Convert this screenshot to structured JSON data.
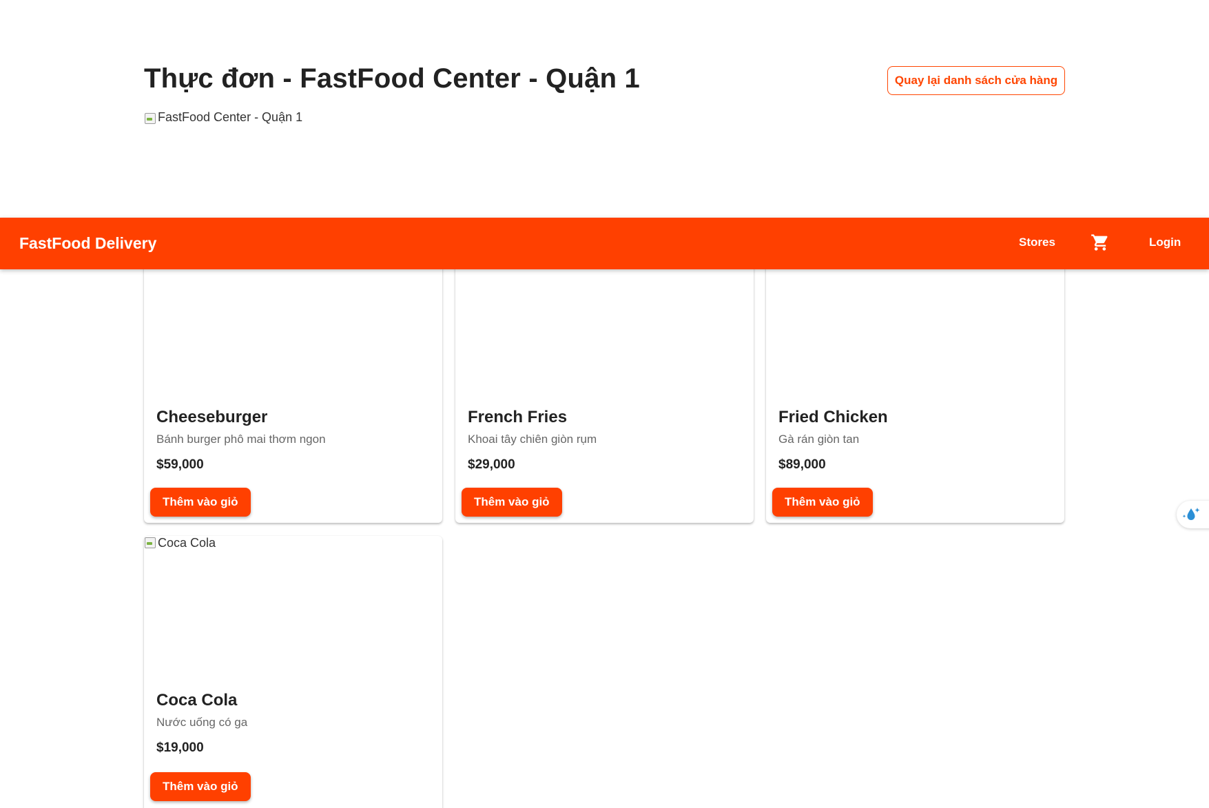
{
  "header": {
    "title": "Thực đơn - FastFood Center - Quận 1",
    "back_button": "Quay lại danh sách cửa hàng",
    "store_image_alt": "FastFood Center - Quận 1"
  },
  "navbar": {
    "brand": "FastFood Delivery",
    "stores": "Stores",
    "login": "Login",
    "cart_icon": "shopping-cart-icon"
  },
  "menu": {
    "items": [
      {
        "name": "Cheeseburger",
        "description": "Bánh burger phô mai thơm ngon",
        "price": "$59,000",
        "image_alt": "",
        "button": "Thêm vào giỏ"
      },
      {
        "name": "French Fries",
        "description": "Khoai tây chiên giòn rụm",
        "price": "$29,000",
        "image_alt": "",
        "button": "Thêm vào giỏ"
      },
      {
        "name": "Fried Chicken",
        "description": "Gà rán giòn tan",
        "price": "$89,000",
        "image_alt": "",
        "button": "Thêm vào giỏ"
      },
      {
        "name": "Coca Cola",
        "description": "Nước uống có ga",
        "price": "$19,000",
        "image_alt": "Coca Cola",
        "button": "Thêm vào giỏ"
      }
    ]
  },
  "colors": {
    "accent": "#ff4000",
    "navbar": "#ff4000",
    "text": "#222222",
    "muted": "#666666"
  },
  "widget": {
    "icon": "water-drop-sparkle-icon"
  }
}
